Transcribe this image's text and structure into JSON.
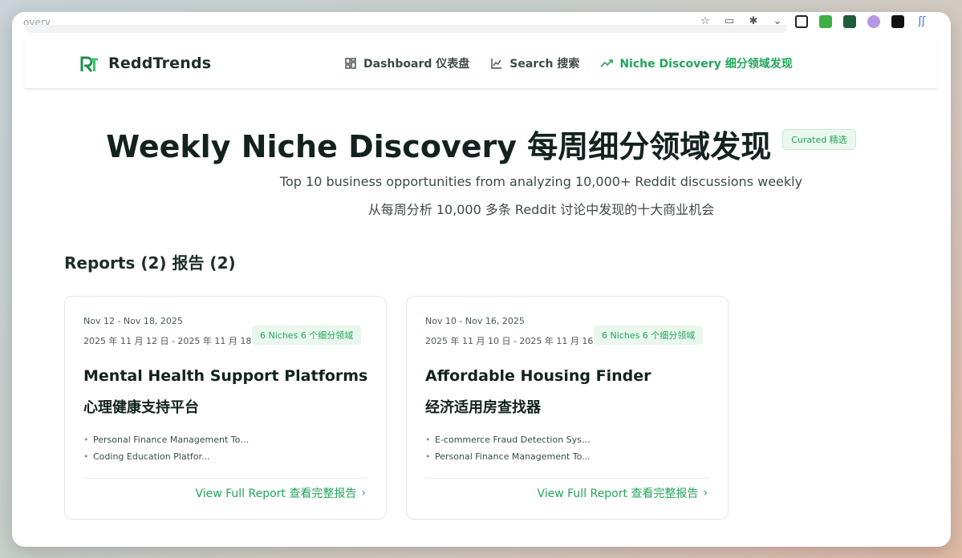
{
  "browser": {
    "url_fragment": "overy",
    "icons": [
      "star-icon",
      "reader-icon",
      "translate-icon",
      "chevron-down-icon",
      "extension-icon-1",
      "extension-icon-2",
      "extension-icon-3",
      "extension-icon-4",
      "extension-icon-5",
      "extension-icon-6"
    ]
  },
  "nav": {
    "brand": "ReddTrends",
    "links": [
      {
        "label": "Dashboard  仪表盘",
        "icon": "dashboard-icon",
        "active": false
      },
      {
        "label": "Search  搜索",
        "icon": "chart-icon",
        "active": false
      },
      {
        "label": "Niche Discovery  细分领域发现",
        "icon": "trending-up-icon",
        "active": true
      }
    ]
  },
  "hero": {
    "title": "Weekly Niche Discovery  每周细分领域发现",
    "badge": "Curated  精选",
    "subtitle_en": "Top 10 business opportunities from analyzing 10,000+ Reddit discussions weekly",
    "subtitle_zh": "从每周分析 10,000 多条 Reddit 讨论中发现的十大商业机会"
  },
  "reports": {
    "heading": "Reports (2)  报告 (2)",
    "cards": [
      {
        "date_en": "Nov 12 - Nov 18, 2025",
        "date_zh": "2025 年 11 月 12 日 - 2025 年 11 月 18 日",
        "niches": "6 Niches  6 个细分领域",
        "title_en": "Mental Health Support Platforms",
        "title_zh": "心理健康支持平台",
        "items": [
          "Personal Finance Management Too...",
          "Coding Education Platfor..."
        ],
        "link": "View Full Report  查看完整报告"
      },
      {
        "date_en": "Nov 10 - Nov 16, 2025",
        "date_zh": "2025 年 11 月 10 日 - 2025 年 11 月 16 日",
        "niches": "6 Niches  6 个细分领域",
        "title_en": "Affordable Housing Finder",
        "title_zh": "经济适用房查找器",
        "items": [
          "E-commerce Fraud Detection Syste...",
          "Personal Finance Management To..."
        ],
        "link": "View Full Report  查看完整报告"
      }
    ]
  },
  "colors": {
    "accent": "#22a55a",
    "text": "#14221f",
    "muted": "#3c4a47"
  }
}
